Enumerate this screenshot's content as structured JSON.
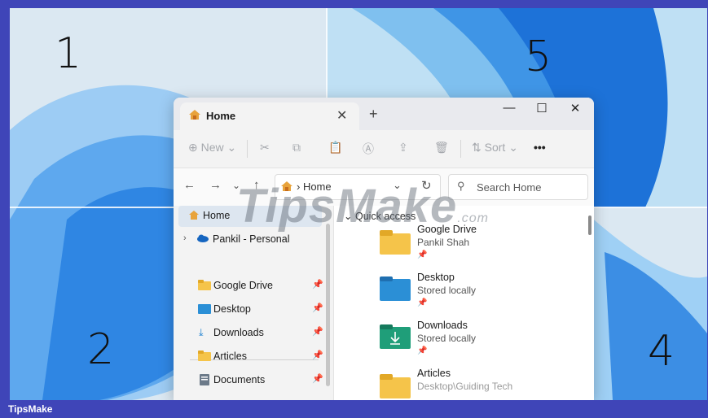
{
  "quadrants": {
    "q1": "1",
    "q5": "5",
    "q2": "2",
    "q4": "4"
  },
  "window": {
    "tab_title": "Home",
    "new_tab": "+",
    "commands": {
      "new": "New",
      "sort": "Sort",
      "more": "•••"
    },
    "address": {
      "crumb": "› Home"
    },
    "search_placeholder": "Search Home"
  },
  "nav_pane": {
    "items": [
      {
        "label": "Home",
        "icon": "home-icon"
      },
      {
        "label": "Pankil - Personal",
        "icon": "cloud-icon"
      },
      {
        "label": "Google Drive",
        "icon": "folder-icon",
        "pinned": true
      },
      {
        "label": "Desktop",
        "icon": "desktop-folder-icon",
        "pinned": true
      },
      {
        "label": "Downloads",
        "icon": "download-icon",
        "pinned": true
      },
      {
        "label": "Articles",
        "icon": "folder-icon",
        "pinned": true
      },
      {
        "label": "Documents",
        "icon": "documents-icon",
        "pinned": true
      }
    ]
  },
  "quick_access": {
    "header": "Quick access",
    "items": [
      {
        "name": "Google Drive",
        "sub": "Pankil Shah"
      },
      {
        "name": "Desktop",
        "sub": "Stored locally"
      },
      {
        "name": "Downloads",
        "sub": "Stored locally"
      },
      {
        "name": "Articles",
        "sub": "Desktop\\Guiding Tech"
      }
    ]
  },
  "watermark": {
    "main": "TipsMake",
    "suffix": ".com"
  },
  "footer": {
    "brand": "TipsMake"
  },
  "colors": {
    "frame": "#3f45b8",
    "bloom": "#3f8fe6",
    "folder_yellow": "#f5c44a",
    "desktop_blue": "#2b8fd6",
    "downloads_green": "#1f9e79"
  }
}
